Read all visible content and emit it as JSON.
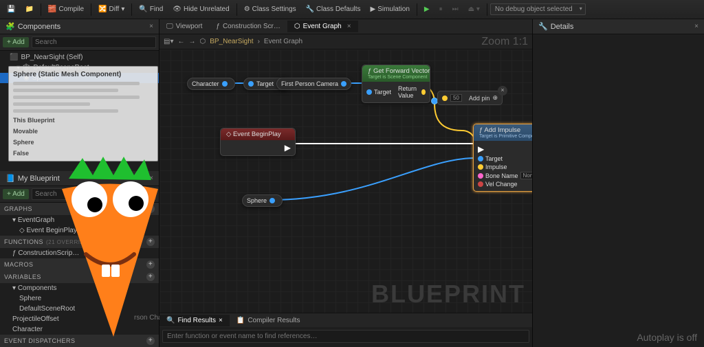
{
  "toolbar": {
    "compile": "Compile",
    "diff": "Diff",
    "find": "Find",
    "hide_unrelated": "Hide Unrelated",
    "class_settings": "Class Settings",
    "class_defaults": "Class Defaults",
    "simulation": "Simulation",
    "debug_dropdown": "No debug object selected"
  },
  "components_panel": {
    "title": "Components",
    "add": "+ Add",
    "search_placeholder": "Search",
    "tree": {
      "root": "BP_NearSight (Self)",
      "scene_root": "DefaultSceneRoot",
      "sphere": "Sphere"
    },
    "tooltip": {
      "title": "Sphere (Static Mesh Component)",
      "class_label": "This Blueprint",
      "mobility_label": "Movable",
      "name_label": "Sphere",
      "editable_label": "False"
    }
  },
  "my_blueprint": {
    "title": "My Blueprint",
    "add": "+ Add",
    "search_placeholder": "Search",
    "sections": {
      "graphs": "GRAPHS",
      "event_graph": "EventGraph",
      "event_begin_play": "Event BeginPlay",
      "functions": "FUNCTIONS",
      "functions_note": "(21 OVERRID…",
      "construction": "ConstructionScrip…",
      "macros": "MACROS",
      "variables": "VARIABLES",
      "components": "Components",
      "sphere": "Sphere",
      "default_scene_root": "DefaultSceneRoot",
      "projectile_offset": "ProjectileOffset",
      "character": "Character",
      "event_dispatchers": "EVENT DISPATCHERS"
    },
    "overlay_text": "rson Charac…"
  },
  "center": {
    "tabs": {
      "viewport": "Viewport",
      "construction": "Construction Scr…",
      "event_graph": "Event Graph"
    },
    "breadcrumb_bp": "BP_NearSight",
    "breadcrumb_graph": "Event Graph",
    "zoom": "Zoom 1:1",
    "watermark": "BLUEPRINT",
    "nodes": {
      "character": "Character",
      "target": "Target",
      "fp_camera": "First Person Camera",
      "sphere": "Sphere",
      "get_forward": {
        "title": "Get Forward Vector",
        "sub": "Target is Scene Component",
        "pin_target": "Target",
        "pin_return": "Return Value"
      },
      "begin_play": {
        "title": "Event BeginPlay"
      },
      "add_impulse": {
        "title": "Add Impulse",
        "sub": "Target is Primitive Compo",
        "target": "Target",
        "impulse": "Impulse",
        "bone_name": "Bone Name",
        "bone_val": "None",
        "vel_change": "Vel Change"
      },
      "addpin": {
        "label": "Add pin",
        "val": "50"
      }
    },
    "bottom": {
      "find_results": "Find Results",
      "compiler_results": "Compiler Results",
      "search_placeholder": "Enter function or event name to find references…"
    }
  },
  "details": {
    "title": "Details"
  },
  "autoplay": "Autoplay is off"
}
